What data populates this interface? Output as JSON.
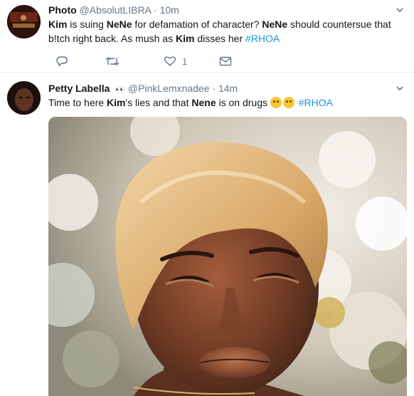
{
  "tweets": [
    {
      "name": "Photo",
      "handle": "@AbsolutLIBRA",
      "time": "10m",
      "text_parts": [
        "Kim",
        " is suing ",
        "NeNe",
        " for defamation of character? ",
        "NeNe",
        " should countersue that b!tch right back. As mush as ",
        "Kim",
        " disses her ",
        "#RHOA"
      ],
      "actions": {
        "reply": "",
        "retweet": "",
        "like_count": "1",
        "dm": ""
      }
    },
    {
      "name": "Petty Labella",
      "eyes_emoji": "👀",
      "handle": "@PinkLemxnadee",
      "time": "14m",
      "text_parts": [
        "Time to here ",
        "Kim",
        "'s lies and that ",
        "Nene",
        " is on drugs ",
        "#RHOA"
      ],
      "media_alt": ""
    }
  ],
  "separator": "·",
  "colors": {
    "link": "#1b95e0",
    "secondary": "#657786",
    "text": "#14171a",
    "divider": "#e6ecf0"
  },
  "icons": [
    "avatar",
    "chevron-down-icon",
    "reply-icon",
    "retweet-icon",
    "like-icon",
    "dm-icon",
    "emoji-icon"
  ]
}
